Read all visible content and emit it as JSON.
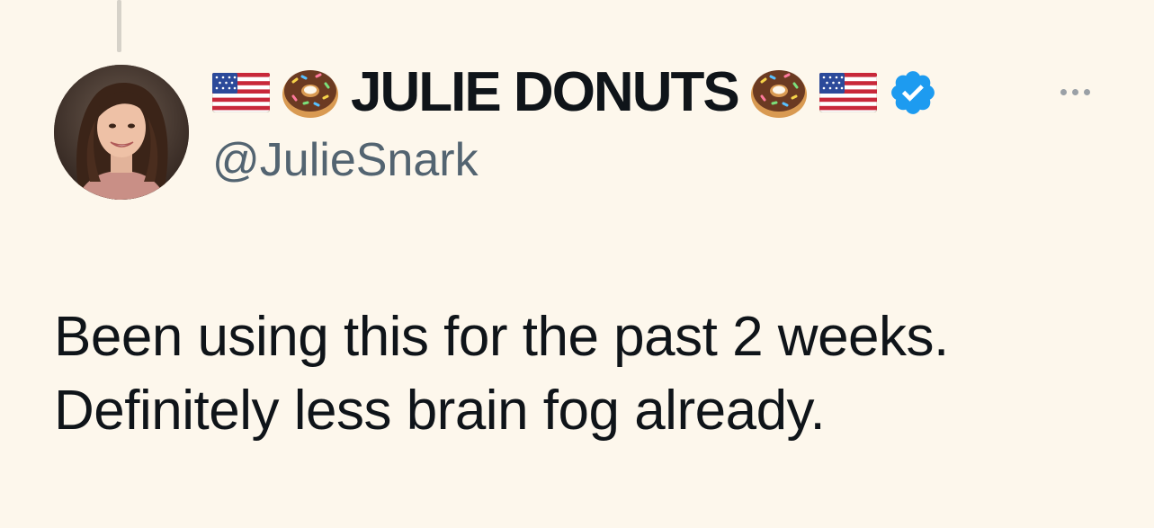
{
  "tweet": {
    "author": {
      "display_name": "JULIE DONUTS",
      "handle": "@JulieSnark",
      "verified": true,
      "leading_emojis": [
        "us-flag-icon",
        "donut-icon"
      ],
      "trailing_emojis": [
        "donut-icon",
        "us-flag-icon"
      ],
      "badge_icon": "verified-badge-icon",
      "badge_color": "#1d9bf0"
    },
    "text_lines": [
      "Been using this for the past 2 weeks.",
      "Definitely less brain fog already."
    ],
    "more_icon": "more-options-icon"
  },
  "colors": {
    "background": "#fdf7ec",
    "text": "#0f1419",
    "secondary_text": "#536471"
  }
}
